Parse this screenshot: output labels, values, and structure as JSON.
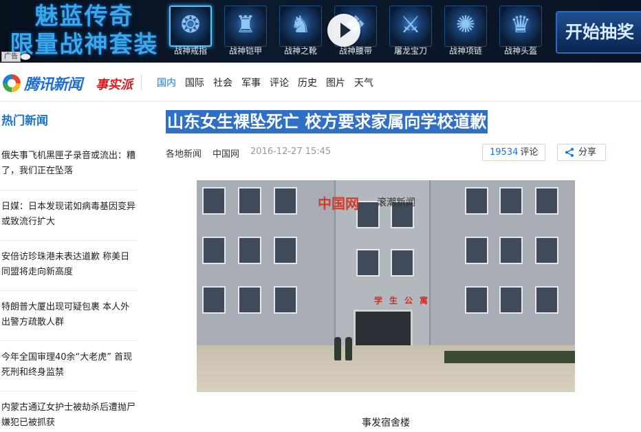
{
  "banner": {
    "title_line1": "魅蓝传奇",
    "title_line2": "限量战神套装",
    "ad_label": "广告",
    "items": [
      {
        "label": "战神戒指",
        "icon": "ring-icon"
      },
      {
        "label": "战神铠甲",
        "icon": "armor-icon"
      },
      {
        "label": "战神之靴",
        "icon": "boots-icon"
      },
      {
        "label": "战神腰带",
        "icon": "belt-icon"
      },
      {
        "label": "屠龙宝刀",
        "icon": "sword-icon"
      },
      {
        "label": "战神项链",
        "icon": "necklace-icon"
      },
      {
        "label": "战神头盔",
        "icon": "helmet-icon"
      }
    ],
    "cta_label": "开始抽奖"
  },
  "header": {
    "logo_text": "腾讯新闻",
    "logo_sub": "事实派",
    "nav": [
      "国内",
      "国际",
      "社会",
      "军事",
      "评论",
      "历史",
      "图片",
      "天气"
    ],
    "active_nav": "国内"
  },
  "sidebar": {
    "title": "热门新闻",
    "items": [
      "俄失事飞机黑匣子录音或流出：糟了，我们正在坠落",
      "日媒：日本发现诺如病毒基因变异 或致流行扩大",
      "安倍访珍珠港未表达道歉 称美日同盟将走向新高度",
      "特朗普大厦出现可疑包裹 本人外出警方疏散人群",
      "今年全国审理40余“大老虎” 首现死刑和终身监禁",
      "内蒙古通辽女护士被劫杀后遭抛尸 嫌犯已被抓获"
    ]
  },
  "article": {
    "headline": "山东女生裸坠死亡 校方要求家属向学校道歉",
    "category": "各地新闻",
    "source": "中国网",
    "time": "2016-12-27 15:45",
    "comment_count": "19534",
    "comment_label": "评论",
    "share_label": "分享",
    "photo_sign": "学生公寓",
    "photo_watermark": "中国网",
    "photo_watermark2": "滚潮新闻",
    "caption": "事发宿舍楼"
  },
  "colors": {
    "accent": "#1a74d6",
    "headline_bg": "#2f6fc5",
    "brand_red": "#d71c1c"
  }
}
